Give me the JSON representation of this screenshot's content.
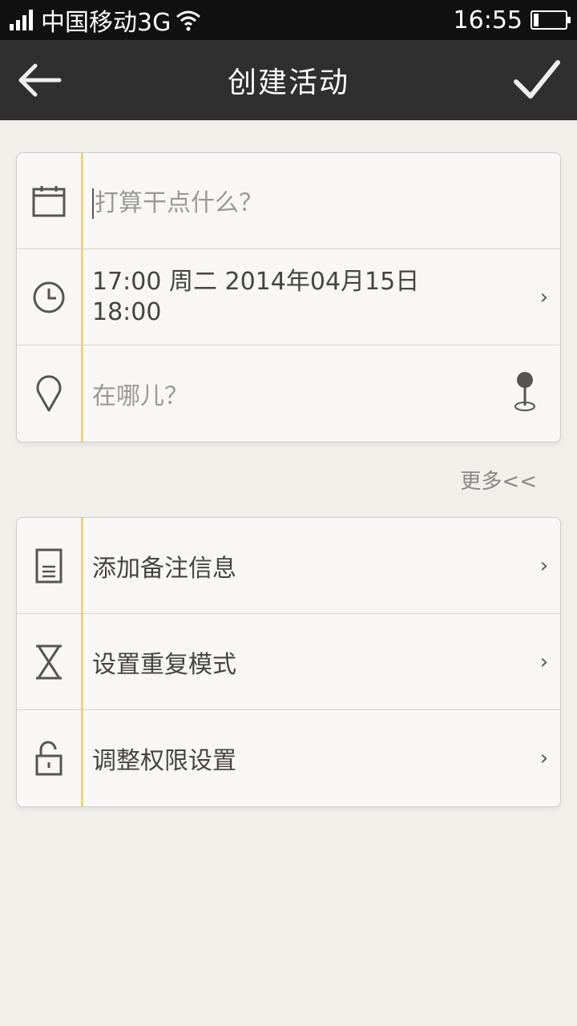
{
  "status_bar": {
    "carrier": "中国移动3G",
    "time": "16:55"
  },
  "header": {
    "title": "创建活动"
  },
  "form": {
    "title_placeholder": "打算干点什么？",
    "time_line1": "17:00 周二 2014年04月15日",
    "time_line2": "18:00",
    "location_placeholder": "在哪儿？"
  },
  "more_link": "更多<<",
  "options": {
    "notes": "添加备注信息",
    "repeat": "设置重复模式",
    "permissions": "调整权限设置"
  },
  "colors": {
    "title_bar": "#2f2f2f",
    "status_bar": "#111111",
    "accent_line": "#f0d27a",
    "background": "#f1efea"
  }
}
